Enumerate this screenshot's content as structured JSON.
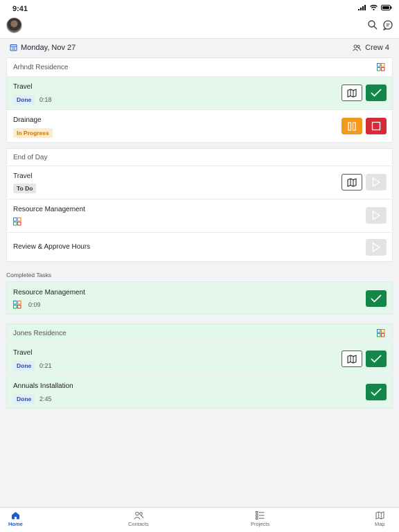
{
  "status": {
    "time": "9:41"
  },
  "date_bar": {
    "date": "Monday, Nov 27",
    "crew": "Crew 4"
  },
  "completed_label": "Completed Tasks",
  "cards": {
    "arhndt": {
      "title": "Arhndt Residence",
      "rows": [
        {
          "name": "Travel",
          "status": "Done",
          "duration": "0:18"
        },
        {
          "name": "Drainage",
          "status": "In Progress"
        }
      ]
    },
    "eod": {
      "title": "End of Day",
      "rows": [
        {
          "name": "Travel",
          "status": "To Do"
        },
        {
          "name": "Resource Management"
        },
        {
          "name": "Review & Approve Hours"
        }
      ]
    },
    "completed": {
      "rows": [
        {
          "name": "Resource Management",
          "duration": "0:09"
        }
      ]
    },
    "jones": {
      "title": "Jones Residence",
      "rows": [
        {
          "name": "Travel",
          "status": "Done",
          "duration": "0:21"
        },
        {
          "name": "Annuals Installation",
          "status": "Done",
          "duration": "2:45"
        }
      ]
    }
  },
  "tabs": [
    {
      "label": "Home",
      "icon": "home-icon",
      "active": true
    },
    {
      "label": "Contacts",
      "icon": "contacts-icon"
    },
    {
      "label": "Projects",
      "icon": "projects-icon"
    },
    {
      "label": "Map",
      "icon": "map-icon"
    }
  ],
  "colors": {
    "accent": "#1e5bd0",
    "done_green": "#128748",
    "row_green": "#e3f7ea",
    "pause_orange": "#f39a1d",
    "stop_red": "#d42b37"
  }
}
